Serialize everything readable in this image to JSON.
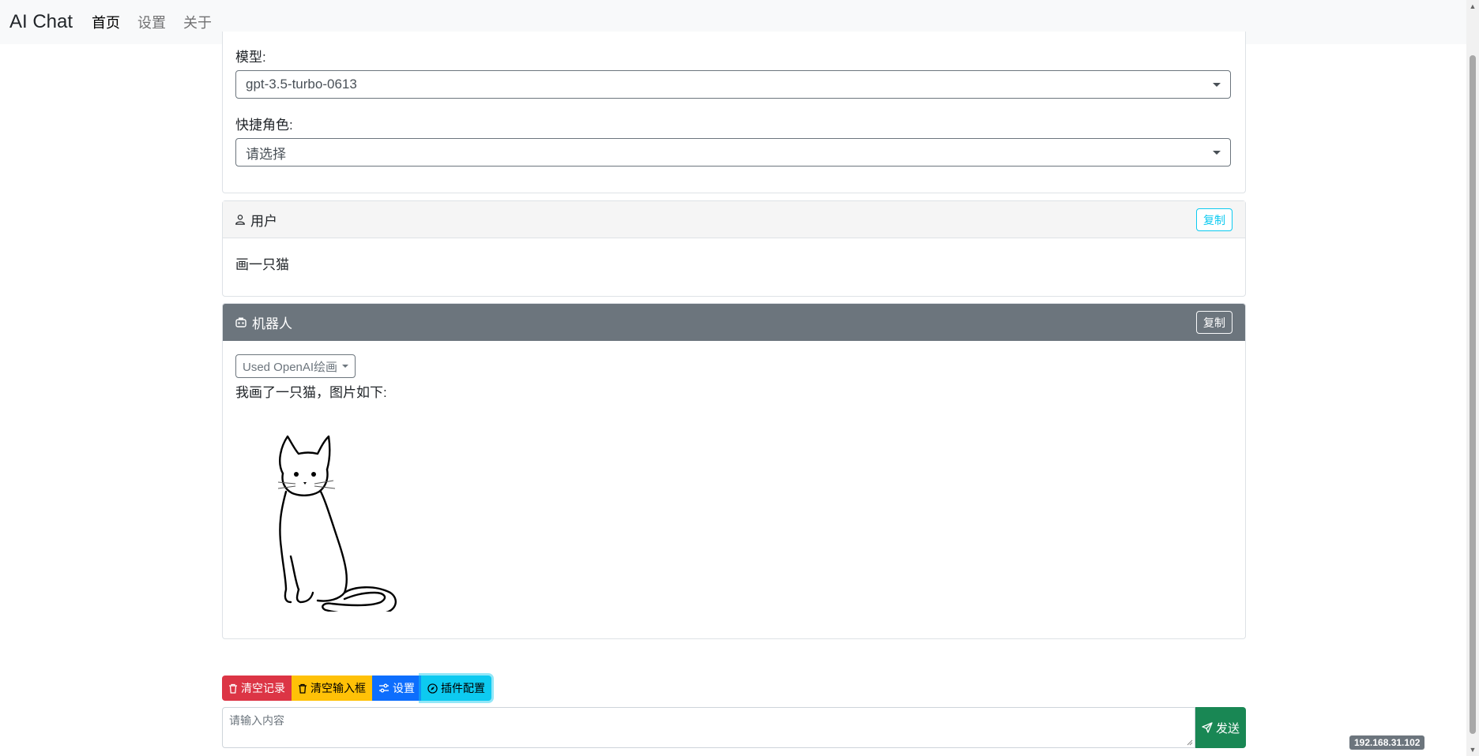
{
  "navbar": {
    "brand": "AI Chat",
    "links": [
      {
        "label": "首页",
        "active": true
      },
      {
        "label": "设置",
        "active": false
      },
      {
        "label": "关于",
        "active": false
      }
    ]
  },
  "settings_card": {
    "model_label": "模型:",
    "model_value": "gpt-3.5-turbo-0613",
    "role_label": "快捷角色:",
    "role_value": "请选择"
  },
  "messages": [
    {
      "role_label": "用户",
      "role_icon": "user-icon",
      "copy_label": "复制",
      "text": "画一只猫"
    },
    {
      "role_label": "机器人",
      "role_icon": "robot-icon",
      "copy_label": "复制",
      "plugin_dropdown": "Used OpenAI绘画",
      "text": "我画了一只猫，图片如下:",
      "image": "cat-drawing"
    }
  ],
  "toolbar": {
    "clear_history": "清空记录",
    "clear_input": "清空输入框",
    "settings": "设置",
    "plugin_config": "插件配置"
  },
  "composer": {
    "placeholder": "请输入内容",
    "send_label": "发送"
  },
  "ip_badge": "192.168.31.102",
  "colors": {
    "danger": "#dc3545",
    "warning": "#ffc107",
    "primary": "#0d6efd",
    "info": "#0dcaf0",
    "success": "#198754",
    "secondary": "#6c757d"
  }
}
